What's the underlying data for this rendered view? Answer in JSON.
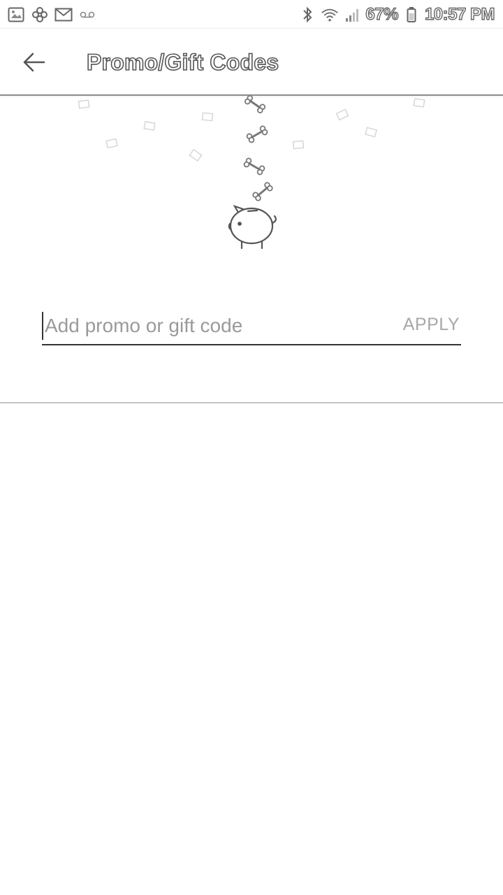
{
  "status_bar": {
    "battery": "67%",
    "time": "10:57 PM",
    "left_icons": [
      "gallery-icon",
      "pinwheel-icon",
      "gmail-icon",
      "voicemail-icon"
    ],
    "right_icons": [
      "bluetooth-icon",
      "wifi-icon",
      "signal-icon",
      "battery-icon"
    ]
  },
  "app_bar": {
    "title": "Promo/Gift Codes",
    "back_icon": "arrow-left-icon"
  },
  "illustration": {
    "icons": [
      "bone-icon",
      "piggy-bank-icon",
      "confetti-icon"
    ]
  },
  "promo": {
    "placeholder": "Add promo or gift code",
    "value": "",
    "apply_label": "APPLY"
  },
  "colors": {
    "background": "#ffffff",
    "divider": "#c4c4c4",
    "apply_text": "#a8a8a8",
    "placeholder_text": "#9a9a9a",
    "underline": "#333333"
  }
}
